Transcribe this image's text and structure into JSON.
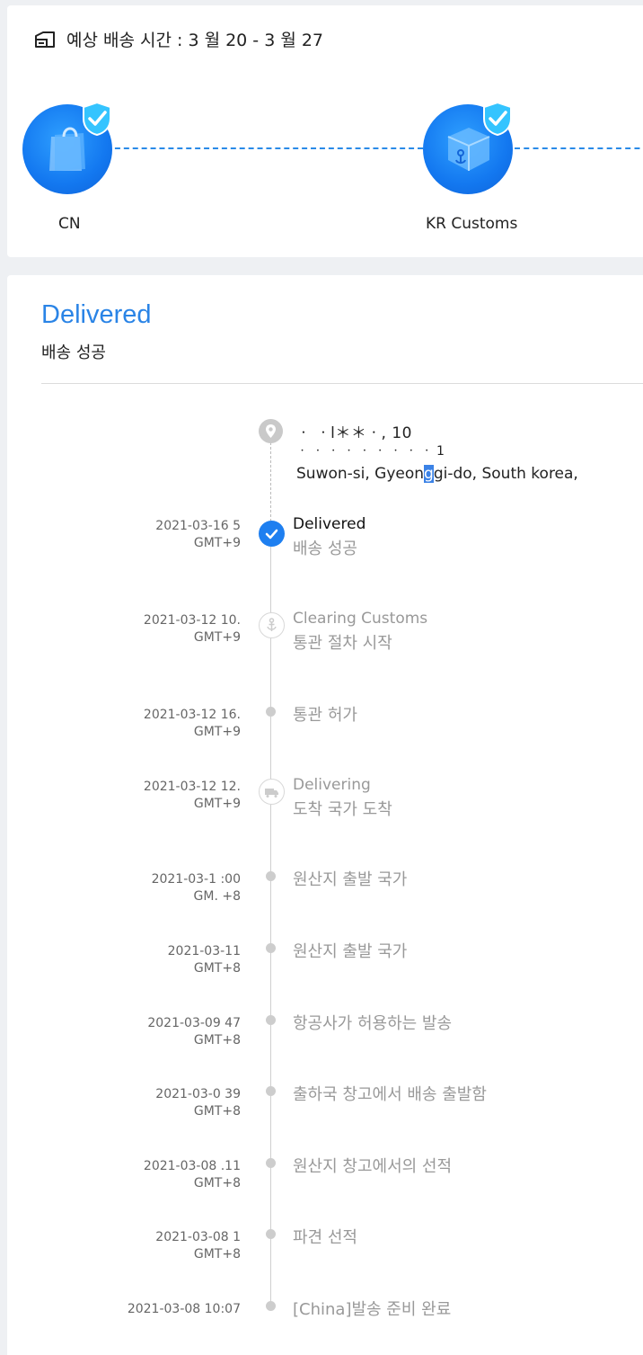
{
  "estimate": {
    "text": "예상 배송 시간 : 3 월 20 - 3 월 27"
  },
  "progress": {
    "nodes": [
      {
        "label": "CN",
        "icon": "shopping-bag-icon",
        "verified": true
      },
      {
        "label": "KR Customs",
        "icon": "customs-box-icon",
        "verified": true
      }
    ],
    "accent_color": "#1378f0"
  },
  "status": {
    "title": "Delivered",
    "subtitle": "배송 성공",
    "color": "#2a84e6"
  },
  "address": {
    "line1": "ㆍ  ㆍl＊＊ㆍ,  10",
    "line2": "ㆍ ㆍ ㆍ ㆍ ㆍ ㆍ ㆍ ㆍ ㆍ 1",
    "line3_pre": "Suwon-si,  Gyeon",
    "line3_hl": "g",
    "line3_post": "gi-do,  South korea,",
    "icon": "location-pin-icon"
  },
  "events": [
    {
      "date": "2021-03-16         5",
      "tz": "GMT+9",
      "title": "Delivered",
      "desc": "배송 성공",
      "icon": "check-icon"
    },
    {
      "date": "2021-03-12 10.",
      "tz": "GMT+9",
      "title": "Clearing Customs",
      "desc": "통관 절차 시작",
      "icon": "anchor-icon"
    },
    {
      "date": "2021-03-12 16.",
      "tz": "GMT+9",
      "title": "",
      "desc": "통관 허가",
      "icon": "dot"
    },
    {
      "date": "2021-03-12 12.",
      "tz": "GMT+9",
      "title": "Delivering",
      "desc": "도착 국가 도착",
      "icon": "truck-icon"
    },
    {
      "date": "2021-03-1   :00",
      "tz": "GM. +8",
      "title": "",
      "desc": "원산지 출발 국가",
      "icon": "dot"
    },
    {
      "date": "2021-03-11         ",
      "tz": "GMT+8",
      "title": "",
      "desc": "원산지 출발 국가",
      "icon": "dot"
    },
    {
      "date": "2021-03-09       47",
      "tz": "GMT+8",
      "title": "",
      "desc": "항공사가 허용하는 발송",
      "icon": "dot"
    },
    {
      "date": "2021-03-0          39",
      "tz": "GMT+8",
      "title": "",
      "desc": "출하국 창고에서 배송 출발함",
      "icon": "dot"
    },
    {
      "date": "2021-03-08  .11",
      "tz": "GMT+8",
      "title": "",
      "desc": "원산지 창고에서의 선적",
      "icon": "dot"
    },
    {
      "date": "2021-03-08 1",
      "tz": "GMT+8",
      "title": "",
      "desc": "파견 선적",
      "icon": "dot"
    },
    {
      "date": "2021-03-08 10:07",
      "tz": "",
      "title": "",
      "desc": "[China]발송 준비 완료",
      "icon": "dot"
    }
  ]
}
